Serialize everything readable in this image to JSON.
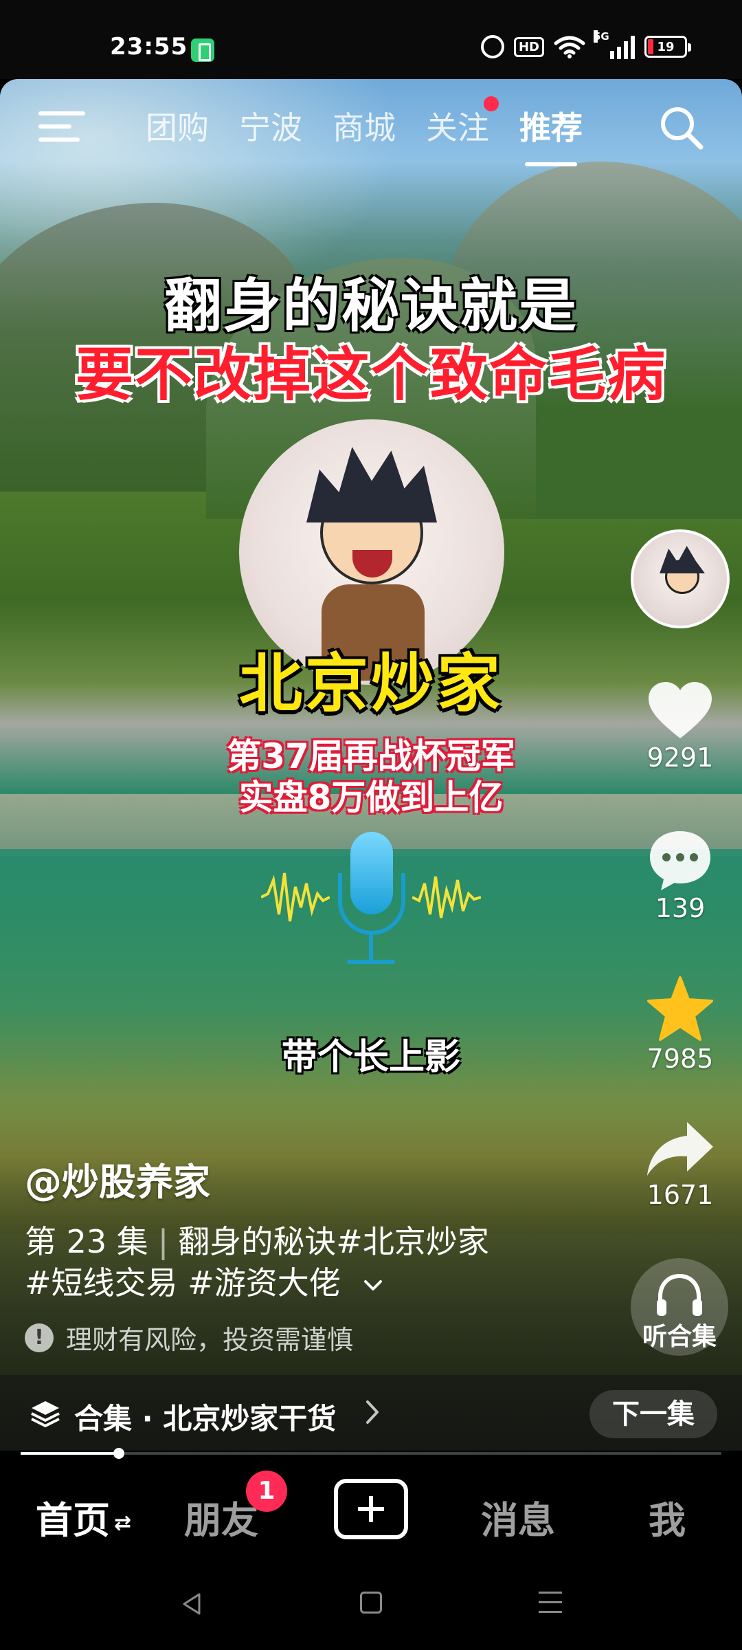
{
  "status_bar": {
    "time": "23:55",
    "hd_label": "HD",
    "network_label": "5G",
    "battery_level": "19",
    "battery_color": "#ff2d3d"
  },
  "top_nav": {
    "tabs": [
      {
        "label": "团购",
        "active": false
      },
      {
        "label": "宁波",
        "active": false
      },
      {
        "label": "商城",
        "active": false
      },
      {
        "label": "关注",
        "active": false
      },
      {
        "label": "推荐",
        "active": true
      }
    ],
    "icons": {
      "menu": "menu-icon",
      "search": "search-icon"
    }
  },
  "video_overlay": {
    "headline_line_1": "翻身的秘诀就是",
    "headline_line_2": "要不改掉这个致命毛病",
    "brand_name": "北京炒家",
    "tag_line_1": "第37届再战杯冠军",
    "tag_line_2": "实盘8万做到上亿",
    "subtitle": "带个长上影"
  },
  "right_rail": {
    "like_count": "9291",
    "comment_count": "139",
    "favorite_count": "7985",
    "share_count": "1671",
    "listen_label": "听合集",
    "favorite_color": "#ffc21c"
  },
  "caption": {
    "author": "@炒股养家",
    "episode": "第 23 集",
    "title_text": "翻身的秘诀#北京炒家",
    "hashtags": "#短线交易 #游资大佬",
    "risk_notice": "理财有风险，投资需谨慎"
  },
  "collection_bar": {
    "label": "合集 · 北京炒家干货",
    "next_button": "下一集",
    "playback_progress": 0.14
  },
  "tab_bar": {
    "home": "首页",
    "friends": "朋友",
    "friends_badge": "1",
    "messages": "消息",
    "me": "我"
  }
}
